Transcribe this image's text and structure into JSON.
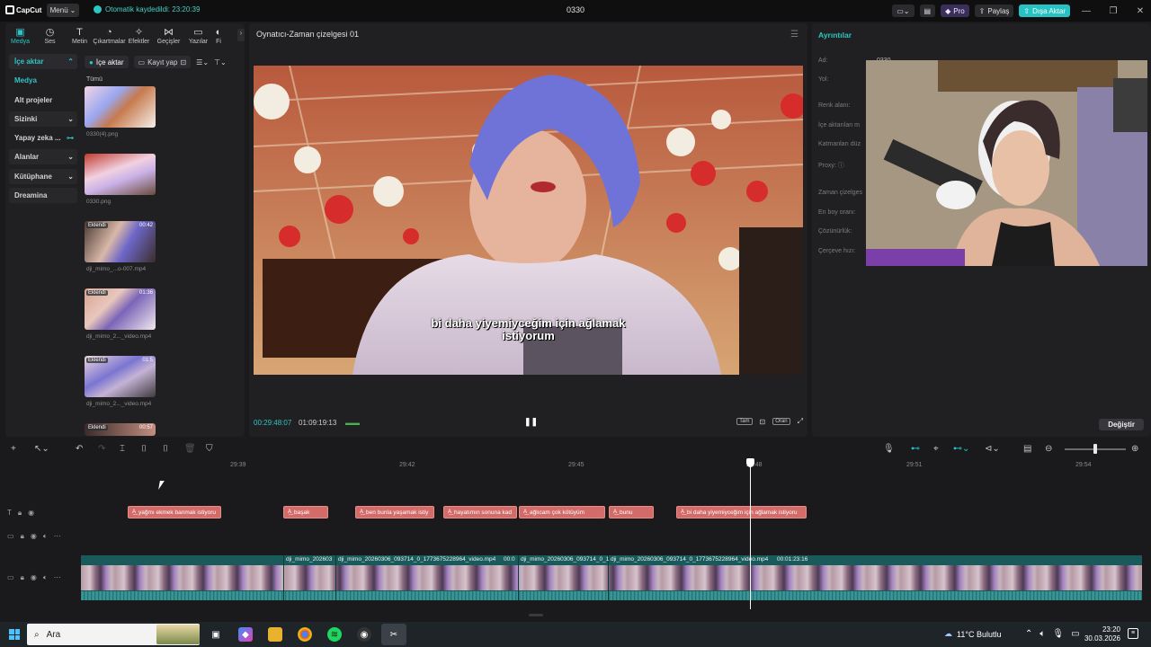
{
  "app": {
    "name": "CapCut",
    "menu_label": "Menü",
    "autosave": "Otomatik kaydedildi: 23:20:39",
    "project_title": "0330",
    "pro": "Pro",
    "share": "Paylaş",
    "export": "Dışa Aktar"
  },
  "tabs": [
    {
      "label": "Medya",
      "icon": "media-icon"
    },
    {
      "label": "Ses",
      "icon": "audio-icon"
    },
    {
      "label": "Metin",
      "icon": "text-icon"
    },
    {
      "label": "Çıkartmalar",
      "icon": "sticker-icon"
    },
    {
      "label": "Efektler",
      "icon": "effects-icon"
    },
    {
      "label": "Geçişler",
      "icon": "transitions-icon"
    },
    {
      "label": "Yazılar",
      "icon": "captions-icon"
    },
    {
      "label": "Fi",
      "icon": "filters-icon"
    }
  ],
  "sidenav": [
    "İçe aktar",
    "Medya",
    "Alt projeler",
    "Sizinki",
    "Yapay zeka ...",
    "Alanlar",
    "Kütüphane",
    "Dreamina"
  ],
  "media_toolbar": {
    "import": "İçe aktar",
    "record": "Kayıt yap"
  },
  "media_all": "Tümü",
  "media": [
    {
      "name": "0330(4).png",
      "tag": "",
      "duration": ""
    },
    {
      "name": "0330.png",
      "tag": "",
      "duration": ""
    },
    {
      "name": "dji_mimo_...o-007.mp4",
      "tag": "Eklendi",
      "duration": "00:42"
    },
    {
      "name": "dji_mimo_2..._video.mp4",
      "tag": "Eklendi",
      "duration": "01:36"
    },
    {
      "name": "dji_mimo_2..._video.mp4",
      "tag": "Eklendi",
      "duration": "01:5"
    },
    {
      "name": "",
      "tag": "Eklendi",
      "duration": "00:57"
    }
  ],
  "player": {
    "title": "Oynatıcı-Zaman çizelgesi 01",
    "subtitle_line1": "bi daha yiyemiyceğim için ağlamak",
    "subtitle_line2": "istiyorum",
    "timecode": "00:29:48:07",
    "duration": "01:09:19:13",
    "full": "Tam",
    "ratio": "Oran"
  },
  "details": {
    "title": "Ayrıntılar",
    "rows": [
      {
        "label": "Ad:",
        "value": "0330"
      },
      {
        "label": "Yol:",
        "value": ""
      },
      {
        "label": "Renk alanı:",
        "value": ""
      },
      {
        "label": "İçe aktarılan m",
        "value": ""
      },
      {
        "label": "Katmanları düz",
        "value": ""
      },
      {
        "label": "Proxy: ⓘ",
        "value": ""
      },
      {
        "label": "Zaman çizelges",
        "value": ""
      },
      {
        "label": "En boy oranı:",
        "value": ""
      },
      {
        "label": "Çözünürlük:",
        "value": ""
      },
      {
        "label": "Çerçeve hızı:",
        "value": ""
      }
    ],
    "change": "Değiştir"
  },
  "ruler": [
    "29:39",
    "29:42",
    "29:45",
    "29:48",
    "29:51",
    "29:54"
  ],
  "subtitle_clips": [
    "yağmı ekmek banmak istiyoru",
    "başak",
    "ben bunla yaşamak istiy",
    "hayatımın sonuna kad",
    "ağlıcam çok kötüyüm",
    "bunu",
    "bi daha yiyemiyceğim için ağlamak istiyoru"
  ],
  "video_clip_labels": [
    "dji_mimo_202603",
    "dji_mimo_20260306_093714_0_1773675228964_video.mp4",
    "00:0",
    "dji_mimo_20260306_093714_0_1",
    "dji_mimo_20260306_093714_0_1773675228964_video.mp4",
    "00:01:23:16"
  ],
  "taskbar": {
    "search": "Ara",
    "weather": "11°C  Bulutlu",
    "time": "23:20",
    "date": "30.03.2026"
  }
}
